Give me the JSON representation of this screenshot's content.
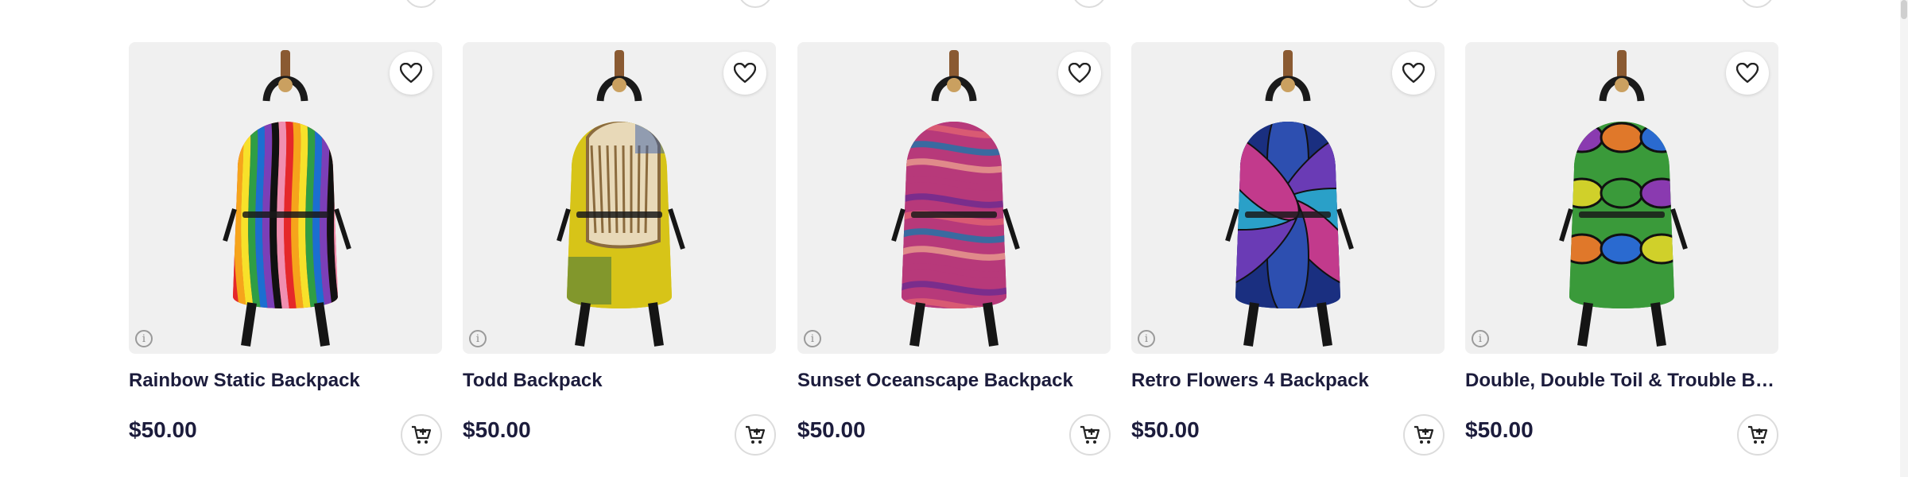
{
  "products": [
    {
      "title": "Rainbow Static Backpack",
      "price": "$50.00",
      "pattern": "rainbow-stripes",
      "colors": [
        "#e5282a",
        "#f6a41b",
        "#f7e12a",
        "#2f9e44",
        "#1b6fd1",
        "#7b3fb8",
        "#111111",
        "#f08fb0"
      ]
    },
    {
      "title": "Todd Backpack",
      "price": "$50.00",
      "pattern": "sketch",
      "colors": [
        "#d7c418",
        "#8b6b3e",
        "#e8d9b8",
        "#4a7a3a",
        "#3a5fa8"
      ]
    },
    {
      "title": "Sunset Oceanscape Backpack",
      "price": "$50.00",
      "pattern": "swirls",
      "colors": [
        "#b7397a",
        "#7a2d8c",
        "#d95a73",
        "#3a6aa0",
        "#e08a8a"
      ]
    },
    {
      "title": "Retro Flowers 4 Backpack",
      "price": "$50.00",
      "pattern": "petals",
      "colors": [
        "#2d4fb0",
        "#6a3bb5",
        "#2aa0c8",
        "#c23a8c",
        "#1a2f80"
      ]
    },
    {
      "title": "Double, Double Toil & Trouble Backpack",
      "price": "$50.00",
      "pattern": "psychedelic",
      "colors": [
        "#3a9a3a",
        "#8a3ab0",
        "#e0782a",
        "#2a6ad0",
        "#d0d02a"
      ]
    }
  ],
  "icons": {
    "favorite": "heart-icon",
    "info": "info-icon",
    "add_to_cart": "cart-plus-icon"
  },
  "info_glyph": "i"
}
